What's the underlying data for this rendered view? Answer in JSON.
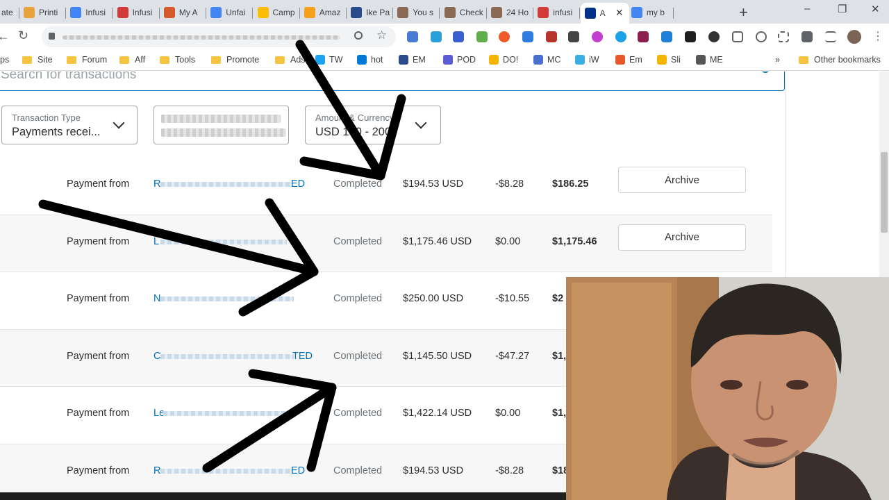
{
  "browser": {
    "tabs": [
      {
        "label": "ate",
        "icon": "generic-tab-icon",
        "color": "#e8a33d"
      },
      {
        "label": "Printi",
        "icon": "printify-icon",
        "color": "#e8a33d"
      },
      {
        "label": "Infusi",
        "icon": "docs-icon",
        "color": "#4285f4"
      },
      {
        "label": "Infusi",
        "icon": "infusionsoft-icon",
        "color": "#d23a3a"
      },
      {
        "label": "My A",
        "icon": "bird-icon",
        "color": "#d55a2b"
      },
      {
        "label": "Unfai",
        "icon": "docs-icon",
        "color": "#4285f4"
      },
      {
        "label": "Camp",
        "icon": "google-ads-icon",
        "color": "#fbbc04"
      },
      {
        "label": "Amaz",
        "icon": "amazon-icon",
        "color": "#f7a01d"
      },
      {
        "label": "Ike Pa",
        "icon": "play-icon",
        "color": "#2b4a8c"
      },
      {
        "label": "You s",
        "icon": "avatar-icon",
        "color": "#8a6a55"
      },
      {
        "label": "Check",
        "icon": "avatar-icon",
        "color": "#8a6a55"
      },
      {
        "label": "24 Ho",
        "icon": "avatar-icon",
        "color": "#8a6a55"
      },
      {
        "label": "infusi",
        "icon": "infusionsoft-icon",
        "color": "#d23a3a"
      },
      {
        "label": "A",
        "icon": "paypal-icon",
        "color": "#003087",
        "active": true
      },
      {
        "label": "my b",
        "icon": "google-icon",
        "color": "#4285f4"
      }
    ],
    "new_tab": "+",
    "window_controls": {
      "minimize": "–",
      "restore": "❐",
      "close": "✕"
    },
    "nav": {
      "back": "←",
      "reload": "↻"
    },
    "bookmarks": [
      {
        "label": "ps",
        "type": "text"
      },
      {
        "label": "Site",
        "type": "folder"
      },
      {
        "label": "Forum",
        "type": "folder"
      },
      {
        "label": "Aff",
        "type": "folder"
      },
      {
        "label": "Tools",
        "type": "folder"
      },
      {
        "label": "Promote",
        "type": "folder"
      },
      {
        "label": "Ads",
        "type": "folder"
      },
      {
        "label": "TW",
        "type": "icon",
        "color": "#1da1f2"
      },
      {
        "label": "hot",
        "type": "icon",
        "color": "#0078d4"
      },
      {
        "label": "EM",
        "type": "icon",
        "color": "#2b4a8c"
      },
      {
        "label": "POD",
        "type": "icon",
        "color": "#5b5bd6"
      },
      {
        "label": "DO!",
        "type": "icon",
        "color": "#f4b400"
      },
      {
        "label": "MC",
        "type": "icon",
        "color": "#4a6fd1"
      },
      {
        "label": "iW",
        "type": "icon",
        "color": "#3ab0e2"
      },
      {
        "label": "Em",
        "type": "icon",
        "color": "#e8572a"
      },
      {
        "label": "Sli",
        "type": "icon",
        "color": "#f4b400"
      },
      {
        "label": "ME",
        "type": "icon",
        "color": "#555555"
      }
    ],
    "bookmarks_overflow": "»",
    "other_bookmarks": "Other bookmarks"
  },
  "search": {
    "placeholder": "Search for transactions"
  },
  "filters": [
    {
      "label": "Transaction Type",
      "value": "Payments recei..."
    },
    {
      "label": "",
      "value": ""
    },
    {
      "label": "Amount & Currency",
      "value": "USD 100 - 2000"
    }
  ],
  "transactions": [
    {
      "type": "Payment from",
      "name_start": "R",
      "name_end": "ED",
      "status": "Completed",
      "gross": "$194.53 USD",
      "fee": "-$8.28",
      "net": "$186.25",
      "action": "Archive"
    },
    {
      "type": "Payment from",
      "name_start": "L",
      "name_end": "",
      "status": "Completed",
      "gross": "$1,175.46 USD",
      "fee": "$0.00",
      "net": "$1,175.46",
      "action": "Archive"
    },
    {
      "type": "Payment from",
      "name_start": "N",
      "name_end": "",
      "status": "Completed",
      "gross": "$250.00 USD",
      "fee": "-$10.55",
      "net": "$2",
      "action": ""
    },
    {
      "type": "Payment from",
      "name_start": "C",
      "name_end": "TED",
      "status": "Completed",
      "gross": "$1,145.50 USD",
      "fee": "-$47.27",
      "net": "$1,",
      "action": ""
    },
    {
      "type": "Payment from",
      "name_start": "Le",
      "name_end": "",
      "status": "Completed",
      "gross": "$1,422.14 USD",
      "fee": "$0.00",
      "net": "$1,",
      "action": ""
    },
    {
      "type": "Payment from",
      "name_start": "R",
      "name_end": "ED",
      "status": "Completed",
      "gross": "$194.53 USD",
      "fee": "-$8.28",
      "net": "$18",
      "action": ""
    }
  ],
  "colors": {
    "paypal_blue": "#0070ba",
    "arrow": "#000000"
  }
}
